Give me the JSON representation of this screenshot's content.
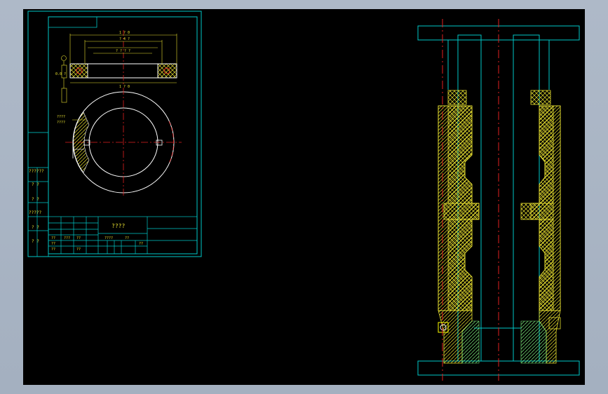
{
  "drawing_sheet": {
    "title_block_title": "????",
    "left_labels": [
      "??????",
      "? ?",
      "? ?",
      "?????",
      "? ?",
      "? ?"
    ],
    "table_cells": [
      "??",
      "???",
      "??",
      "??",
      "??",
      "????",
      "??",
      "??",
      "??"
    ],
    "dims_top": [
      "1 ? 0",
      "? 4 ?",
      "? ? ? ?",
      "1 ? 0"
    ],
    "side_callouts": [
      "0.0 ?",
      "????",
      "????"
    ]
  },
  "colors": {
    "background": "#000000",
    "frame": "#00c8c8",
    "geometry": "#ffffff",
    "centerline": "#e02020",
    "hatch_yellow": "#e8e030",
    "hatch_green": "#7ef07e",
    "highlight": "#ffff00"
  }
}
